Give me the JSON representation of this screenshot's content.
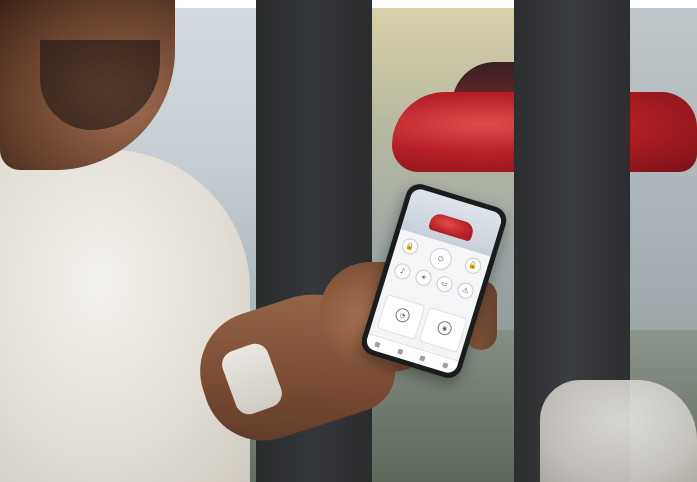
{
  "photo": {
    "subject": "",
    "phone_app": {
      "title": "",
      "section_label": ""
    }
  },
  "colors": {
    "car_red": "#c0242a",
    "window_frame": "#2b2d2f",
    "shirt": "#e8e4dc"
  }
}
